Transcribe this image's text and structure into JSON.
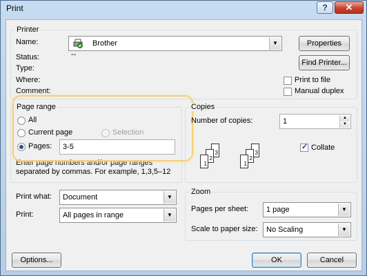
{
  "window": {
    "title": "Print",
    "help": "?",
    "close": "✕"
  },
  "printer": {
    "group_title": "Printer",
    "name_label": "Name:",
    "name_value": "Brother",
    "status_label": "Status:",
    "status_value": "--",
    "type_label": "Type:",
    "where_label": "Where:",
    "comment_label": "Comment:",
    "properties_button": "Properties",
    "find_printer_button": "Find Printer...",
    "print_to_file_label": "Print to file",
    "manual_duplex_label": "Manual duplex"
  },
  "page_range": {
    "group_title": "Page range",
    "all_label": "All",
    "current_page_label": "Current page",
    "selection_label": "Selection",
    "pages_label": "Pages:",
    "pages_value": "3-5",
    "hint_line1": "Enter page numbers and/or page ranges",
    "hint_line2": "separated by commas.  For example, 1,3,5–12"
  },
  "copies": {
    "group_title": "Copies",
    "number_label": "Number of copies:",
    "number_value": "1",
    "collate_label": "Collate",
    "collate_checked": true,
    "page_numbers": [
      "3",
      "2",
      "1"
    ]
  },
  "print_options": {
    "print_what_label": "Print what:",
    "print_what_value": "Document",
    "print_label": "Print:",
    "print_value": "All pages in range"
  },
  "zoom": {
    "group_title": "Zoom",
    "pages_per_sheet_label": "Pages per sheet:",
    "pages_per_sheet_value": "1 page",
    "scale_label": "Scale to paper size:",
    "scale_value": "No Scaling"
  },
  "footer": {
    "options_button": "Options...",
    "ok_button": "OK",
    "cancel_button": "Cancel"
  },
  "icons": {
    "dropdown": "▼",
    "spin_up": "▲",
    "spin_down": "▼",
    "printer_icon": "printer-icon"
  }
}
